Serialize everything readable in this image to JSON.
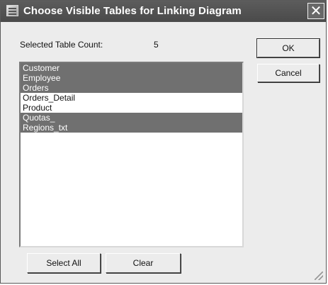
{
  "window": {
    "title": "Choose Visible Tables for Linking Diagram",
    "icon": "app-icon",
    "close_symbol": "✕"
  },
  "count": {
    "label": "Selected Table Count:",
    "value": "5"
  },
  "tables": [
    {
      "name": "Customer",
      "selected": true
    },
    {
      "name": "Employee",
      "selected": true
    },
    {
      "name": "Orders",
      "selected": true
    },
    {
      "name": "Orders_Detail",
      "selected": false
    },
    {
      "name": "Product",
      "selected": false
    },
    {
      "name": "Quotas_",
      "selected": true
    },
    {
      "name": "Regions_txt",
      "selected": true
    }
  ],
  "buttons": {
    "ok": "OK",
    "cancel": "Cancel",
    "select_all": "Select All",
    "clear": "Clear"
  },
  "colors": {
    "selection": "#707070",
    "titlebar": "#4f4f4f"
  }
}
